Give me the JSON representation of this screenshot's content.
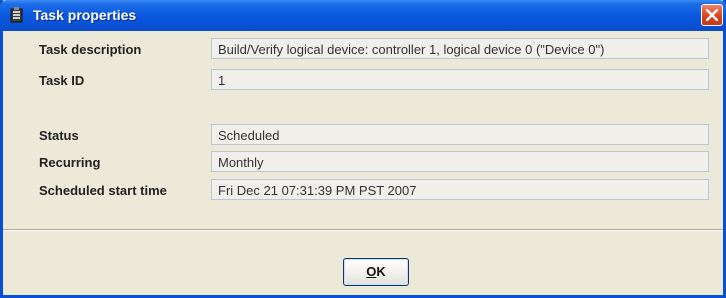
{
  "window": {
    "title": "Task properties",
    "title_icon": "task-properties-icon",
    "close_icon": "close-icon"
  },
  "fields": [
    {
      "label": "Task description",
      "value": "Build/Verify logical device: controller 1, logical device 0 (\"Device 0\")"
    },
    {
      "label": "Task ID",
      "value": "1"
    },
    {
      "label": "Status",
      "value": "Scheduled"
    },
    {
      "label": "Recurring",
      "value": "Monthly"
    },
    {
      "label": "Scheduled start time",
      "value": "Fri Dec 21 07:31:39 PM PST 2007"
    }
  ],
  "buttons": {
    "ok_mnemonic": "O",
    "ok_rest": "K"
  },
  "colors": {
    "titlebar": "#0a4fd8",
    "dialog_bg": "#ece9d8",
    "close_button": "#d8451f",
    "field_border": "#b8c6d7"
  }
}
